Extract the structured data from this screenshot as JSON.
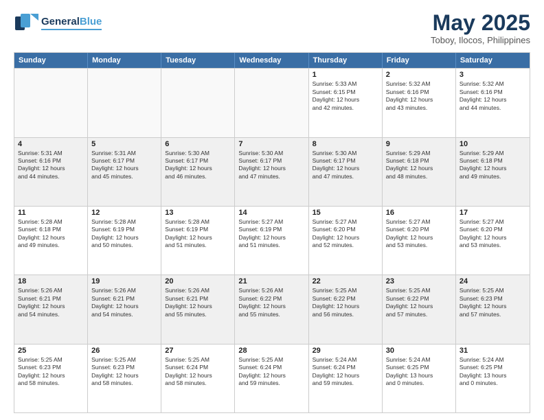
{
  "logo": {
    "line1": "General",
    "line2": "Blue"
  },
  "title": "May 2025",
  "location": "Toboy, Ilocos, Philippines",
  "days": [
    "Sunday",
    "Monday",
    "Tuesday",
    "Wednesday",
    "Thursday",
    "Friday",
    "Saturday"
  ],
  "rows": [
    [
      {
        "day": "",
        "text": ""
      },
      {
        "day": "",
        "text": ""
      },
      {
        "day": "",
        "text": ""
      },
      {
        "day": "",
        "text": ""
      },
      {
        "day": "1",
        "text": "Sunrise: 5:33 AM\nSunset: 6:15 PM\nDaylight: 12 hours\nand 42 minutes."
      },
      {
        "day": "2",
        "text": "Sunrise: 5:32 AM\nSunset: 6:16 PM\nDaylight: 12 hours\nand 43 minutes."
      },
      {
        "day": "3",
        "text": "Sunrise: 5:32 AM\nSunset: 6:16 PM\nDaylight: 12 hours\nand 44 minutes."
      }
    ],
    [
      {
        "day": "4",
        "text": "Sunrise: 5:31 AM\nSunset: 6:16 PM\nDaylight: 12 hours\nand 44 minutes."
      },
      {
        "day": "5",
        "text": "Sunrise: 5:31 AM\nSunset: 6:17 PM\nDaylight: 12 hours\nand 45 minutes."
      },
      {
        "day": "6",
        "text": "Sunrise: 5:30 AM\nSunset: 6:17 PM\nDaylight: 12 hours\nand 46 minutes."
      },
      {
        "day": "7",
        "text": "Sunrise: 5:30 AM\nSunset: 6:17 PM\nDaylight: 12 hours\nand 47 minutes."
      },
      {
        "day": "8",
        "text": "Sunrise: 5:30 AM\nSunset: 6:17 PM\nDaylight: 12 hours\nand 47 minutes."
      },
      {
        "day": "9",
        "text": "Sunrise: 5:29 AM\nSunset: 6:18 PM\nDaylight: 12 hours\nand 48 minutes."
      },
      {
        "day": "10",
        "text": "Sunrise: 5:29 AM\nSunset: 6:18 PM\nDaylight: 12 hours\nand 49 minutes."
      }
    ],
    [
      {
        "day": "11",
        "text": "Sunrise: 5:28 AM\nSunset: 6:18 PM\nDaylight: 12 hours\nand 49 minutes."
      },
      {
        "day": "12",
        "text": "Sunrise: 5:28 AM\nSunset: 6:19 PM\nDaylight: 12 hours\nand 50 minutes."
      },
      {
        "day": "13",
        "text": "Sunrise: 5:28 AM\nSunset: 6:19 PM\nDaylight: 12 hours\nand 51 minutes."
      },
      {
        "day": "14",
        "text": "Sunrise: 5:27 AM\nSunset: 6:19 PM\nDaylight: 12 hours\nand 51 minutes."
      },
      {
        "day": "15",
        "text": "Sunrise: 5:27 AM\nSunset: 6:20 PM\nDaylight: 12 hours\nand 52 minutes."
      },
      {
        "day": "16",
        "text": "Sunrise: 5:27 AM\nSunset: 6:20 PM\nDaylight: 12 hours\nand 53 minutes."
      },
      {
        "day": "17",
        "text": "Sunrise: 5:27 AM\nSunset: 6:20 PM\nDaylight: 12 hours\nand 53 minutes."
      }
    ],
    [
      {
        "day": "18",
        "text": "Sunrise: 5:26 AM\nSunset: 6:21 PM\nDaylight: 12 hours\nand 54 minutes."
      },
      {
        "day": "19",
        "text": "Sunrise: 5:26 AM\nSunset: 6:21 PM\nDaylight: 12 hours\nand 54 minutes."
      },
      {
        "day": "20",
        "text": "Sunrise: 5:26 AM\nSunset: 6:21 PM\nDaylight: 12 hours\nand 55 minutes."
      },
      {
        "day": "21",
        "text": "Sunrise: 5:26 AM\nSunset: 6:22 PM\nDaylight: 12 hours\nand 55 minutes."
      },
      {
        "day": "22",
        "text": "Sunrise: 5:25 AM\nSunset: 6:22 PM\nDaylight: 12 hours\nand 56 minutes."
      },
      {
        "day": "23",
        "text": "Sunrise: 5:25 AM\nSunset: 6:22 PM\nDaylight: 12 hours\nand 57 minutes."
      },
      {
        "day": "24",
        "text": "Sunrise: 5:25 AM\nSunset: 6:23 PM\nDaylight: 12 hours\nand 57 minutes."
      }
    ],
    [
      {
        "day": "25",
        "text": "Sunrise: 5:25 AM\nSunset: 6:23 PM\nDaylight: 12 hours\nand 58 minutes."
      },
      {
        "day": "26",
        "text": "Sunrise: 5:25 AM\nSunset: 6:23 PM\nDaylight: 12 hours\nand 58 minutes."
      },
      {
        "day": "27",
        "text": "Sunrise: 5:25 AM\nSunset: 6:24 PM\nDaylight: 12 hours\nand 58 minutes."
      },
      {
        "day": "28",
        "text": "Sunrise: 5:25 AM\nSunset: 6:24 PM\nDaylight: 12 hours\nand 59 minutes."
      },
      {
        "day": "29",
        "text": "Sunrise: 5:24 AM\nSunset: 6:24 PM\nDaylight: 12 hours\nand 59 minutes."
      },
      {
        "day": "30",
        "text": "Sunrise: 5:24 AM\nSunset: 6:25 PM\nDaylight: 13 hours\nand 0 minutes."
      },
      {
        "day": "31",
        "text": "Sunrise: 5:24 AM\nSunset: 6:25 PM\nDaylight: 13 hours\nand 0 minutes."
      }
    ]
  ]
}
